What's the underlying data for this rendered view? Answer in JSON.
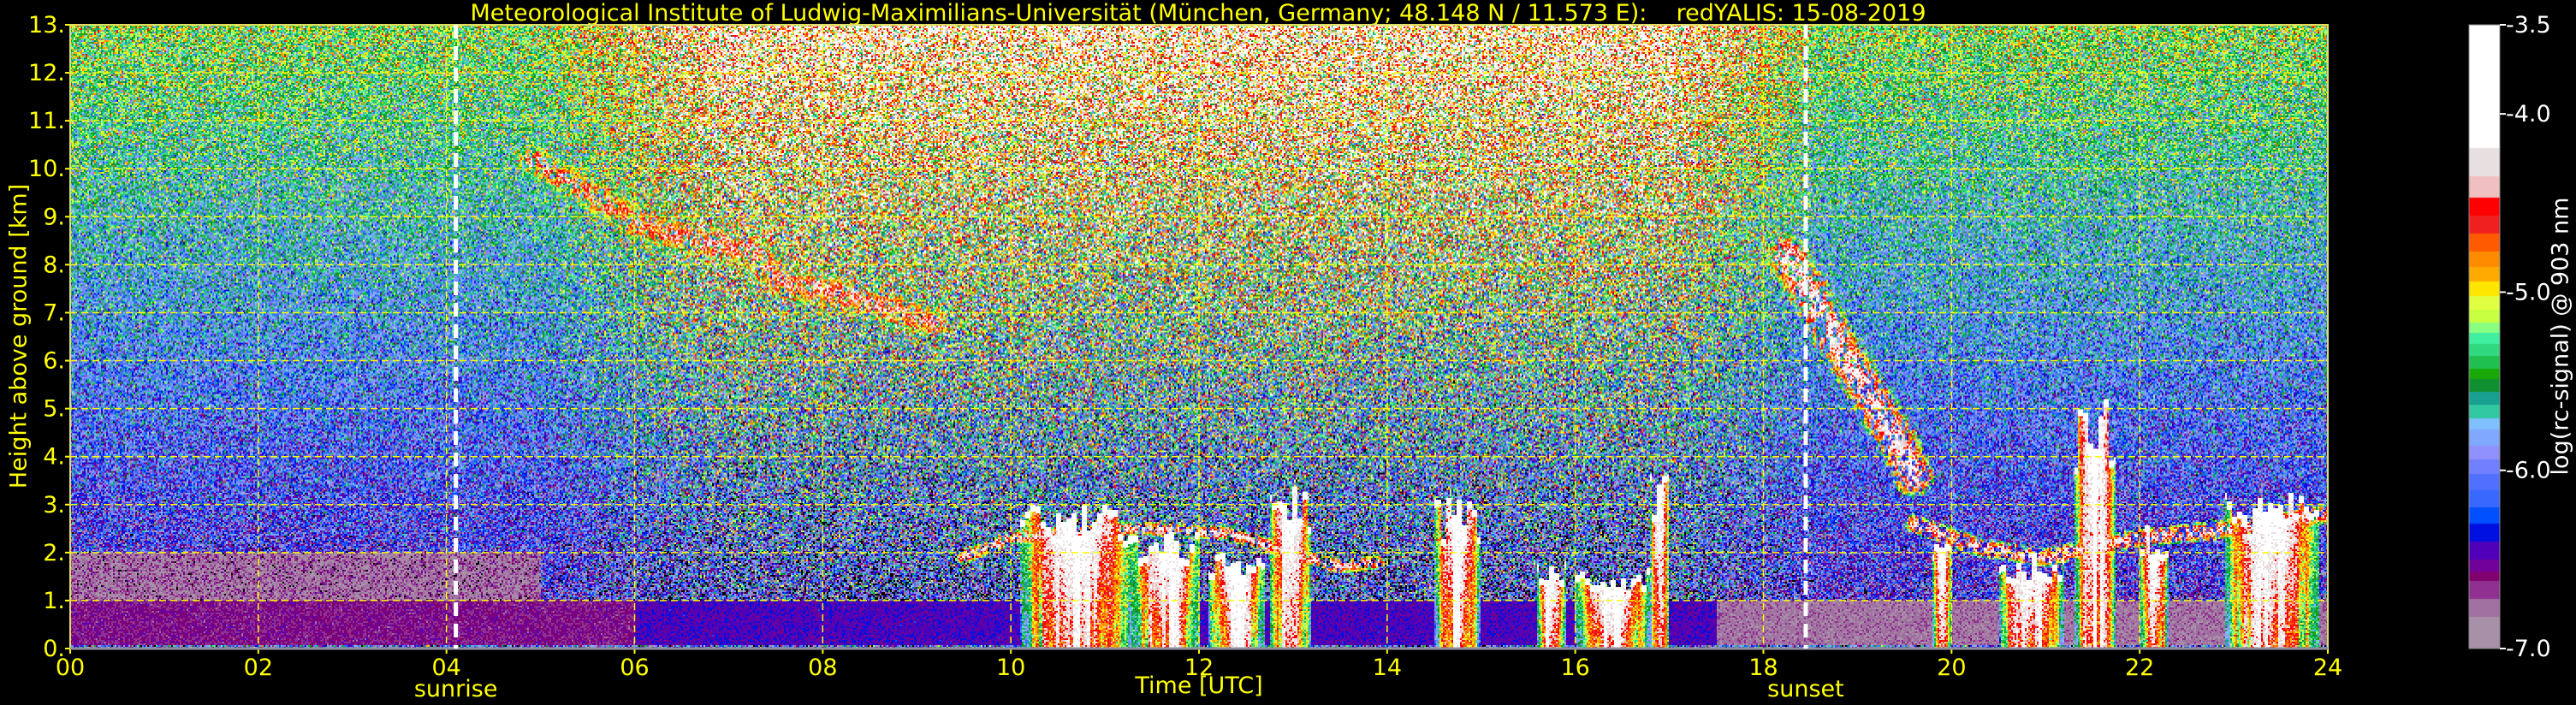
{
  "chart_data": {
    "type": "heatmap",
    "title": "Meteorological Institute of Ludwig-Maximilians-Universität (München, Germany; 48.148 N / 11.573 E):    redYALIS: 15-08-2019",
    "xlabel": "Time [UTC]",
    "ylabel": "Height above ground [km]",
    "xlim": [
      0,
      24
    ],
    "ylim": [
      0,
      13
    ],
    "grid": true,
    "xticks": [
      {
        "value": 0,
        "label": "00"
      },
      {
        "value": 2,
        "label": "02"
      },
      {
        "value": 4,
        "label": "04"
      },
      {
        "value": 6,
        "label": "06"
      },
      {
        "value": 8,
        "label": "08"
      },
      {
        "value": 10,
        "label": "10"
      },
      {
        "value": 12,
        "label": "12"
      },
      {
        "value": 14,
        "label": "14"
      },
      {
        "value": 16,
        "label": "16"
      },
      {
        "value": 18,
        "label": "18"
      },
      {
        "value": 20,
        "label": "20"
      },
      {
        "value": 22,
        "label": "22"
      },
      {
        "value": 24,
        "label": "24"
      }
    ],
    "yticks": [
      {
        "value": 0,
        "label": "0."
      },
      {
        "value": 1,
        "label": "1."
      },
      {
        "value": 2,
        "label": "2."
      },
      {
        "value": 3,
        "label": "3."
      },
      {
        "value": 4,
        "label": "4."
      },
      {
        "value": 5,
        "label": "5."
      },
      {
        "value": 6,
        "label": "6."
      },
      {
        "value": 7,
        "label": "7."
      },
      {
        "value": 8,
        "label": "8."
      },
      {
        "value": 9,
        "label": "9."
      },
      {
        "value": 10,
        "label": "10."
      },
      {
        "value": 11,
        "label": "11."
      },
      {
        "value": 12,
        "label": "12."
      },
      {
        "value": 13,
        "label": "13."
      }
    ],
    "annotations": [
      {
        "label": "sunrise",
        "time": 4.1
      },
      {
        "label": "sunset",
        "time": 18.45
      }
    ],
    "colorbar": {
      "label": "log(rc-signal) @ 903 nm",
      "range": [
        -7.0,
        -3.5
      ],
      "ticks": [
        {
          "value": -3.5,
          "label": "-3.5"
        },
        {
          "value": -4.0,
          "label": "-4.0"
        },
        {
          "value": -5.0,
          "label": "-5.0"
        },
        {
          "value": -6.0,
          "label": "-6.0"
        },
        {
          "value": -7.0,
          "label": "-7.0"
        }
      ],
      "levels": [
        {
          "min": -4.19,
          "color": "#ffffff"
        },
        {
          "min": -4.35,
          "color": "#e8e0e0"
        },
        {
          "min": -4.47,
          "color": "#f0c0c0"
        },
        {
          "min": -4.57,
          "color": "#ff0000"
        },
        {
          "min": -4.67,
          "color": "#f02020"
        },
        {
          "min": -4.77,
          "color": "#ff5a00"
        },
        {
          "min": -4.86,
          "color": "#ff8c00"
        },
        {
          "min": -4.94,
          "color": "#ffaa00"
        },
        {
          "min": -5.02,
          "color": "#ffe600"
        },
        {
          "min": -5.1,
          "color": "#e0ff40"
        },
        {
          "min": -5.17,
          "color": "#c8ff40"
        },
        {
          "min": -5.23,
          "color": "#88ff80"
        },
        {
          "min": -5.29,
          "color": "#40f0a0"
        },
        {
          "min": -5.36,
          "color": "#30d880"
        },
        {
          "min": -5.43,
          "color": "#20c050"
        },
        {
          "min": -5.49,
          "color": "#18a808"
        },
        {
          "min": -5.56,
          "color": "#109030"
        },
        {
          "min": -5.63,
          "color": "#18a090"
        },
        {
          "min": -5.71,
          "color": "#30c8a0"
        },
        {
          "min": -5.77,
          "color": "#80c0ff"
        },
        {
          "min": -5.86,
          "color": "#80a8ff"
        },
        {
          "min": -5.94,
          "color": "#9090ff"
        },
        {
          "min": -6.02,
          "color": "#7080ff"
        },
        {
          "min": -6.11,
          "color": "#5070ff"
        },
        {
          "min": -6.21,
          "color": "#3868ff"
        },
        {
          "min": -6.3,
          "color": "#0050ff"
        },
        {
          "min": -6.4,
          "color": "#0010e0"
        },
        {
          "min": -6.5,
          "color": "#5000b8"
        },
        {
          "min": -6.57,
          "color": "#700098"
        },
        {
          "min": -6.62,
          "color": "#800070"
        },
        {
          "min": -6.72,
          "color": "#903090"
        },
        {
          "min": -6.82,
          "color": "#a070a0"
        },
        {
          "min": -7.0,
          "color": "#a890a8"
        }
      ]
    },
    "features": {
      "thin_layers": [
        {
          "name": "morning-cirrus",
          "value": -4.5,
          "thickness_km": 0.35,
          "points": [
            [
              4.9,
              10.2
            ],
            [
              5.5,
              9.5
            ],
            [
              6.0,
              8.9
            ],
            [
              6.6,
              8.5
            ],
            [
              7.2,
              8.3
            ],
            [
              7.6,
              7.6
            ],
            [
              8.2,
              7.4
            ],
            [
              8.8,
              7.0
            ],
            [
              9.2,
              6.8
            ]
          ]
        },
        {
          "name": "evening-virga",
          "value": -4.2,
          "thickness_km": 0.45,
          "points": [
            [
              18.25,
              8.2
            ],
            [
              18.5,
              7.4
            ],
            [
              18.8,
              6.3
            ],
            [
              19.1,
              5.4
            ],
            [
              19.4,
              4.4
            ],
            [
              19.6,
              3.6
            ]
          ]
        },
        {
          "name": "midday-layer-fragments",
          "value": -4.3,
          "thickness_km": 0.15,
          "points": [
            [
              9.5,
              1.9
            ],
            [
              10.0,
              2.3
            ],
            [
              11.3,
              2.5
            ],
            [
              12.3,
              2.4
            ],
            [
              13.5,
              1.7
            ],
            [
              13.9,
              1.8
            ]
          ]
        },
        {
          "name": "evening-boundary-layer-top",
          "value": -4.3,
          "thickness_km": 0.2,
          "points": [
            [
              19.6,
              2.6
            ],
            [
              20.3,
              2.1
            ],
            [
              21.0,
              1.9
            ],
            [
              22.0,
              2.3
            ],
            [
              23.0,
              2.5
            ],
            [
              24.0,
              2.8
            ]
          ]
        }
      ],
      "cloud_columns": [
        {
          "t0": 10.1,
          "t1": 11.3,
          "top_km": 2.9
        },
        {
          "t0": 11.3,
          "t1": 12.0,
          "top_km": 2.4
        },
        {
          "t0": 12.1,
          "t1": 12.7,
          "top_km": 2.0
        },
        {
          "t0": 12.75,
          "t1": 13.2,
          "top_km": 3.3
        },
        {
          "t0": 14.5,
          "t1": 15.0,
          "top_km": 3.0
        },
        {
          "t0": 15.6,
          "t1": 15.9,
          "top_km": 1.8
        },
        {
          "t0": 16.0,
          "t1": 16.8,
          "top_km": 1.6
        },
        {
          "t0": 16.8,
          "t1": 17.0,
          "top_km": 3.5
        },
        {
          "t0": 19.8,
          "t1": 20.0,
          "top_km": 2.1
        },
        {
          "t0": 20.5,
          "t1": 21.2,
          "top_km": 1.9
        },
        {
          "t0": 21.3,
          "t1": 21.75,
          "top_km": 5.0
        },
        {
          "t0": 22.0,
          "t1": 22.3,
          "top_km": 2.5
        },
        {
          "t0": 22.9,
          "t1": 23.9,
          "top_km": 3.2
        }
      ]
    }
  }
}
